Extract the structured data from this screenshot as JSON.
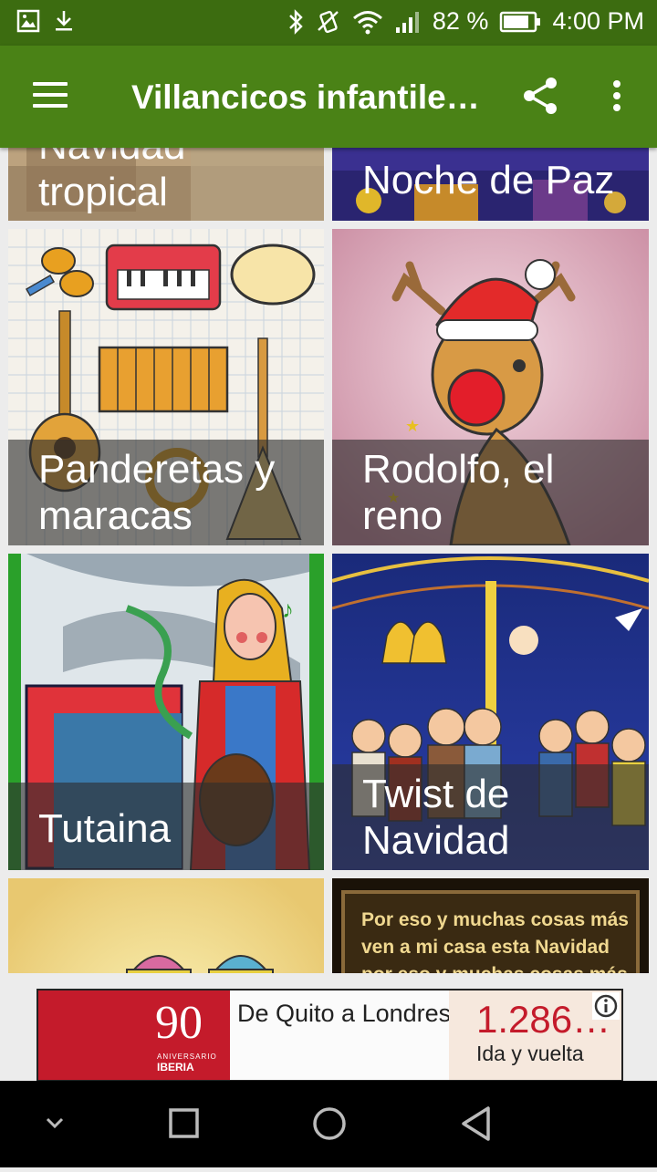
{
  "status_bar": {
    "battery_percent": "82 %",
    "time": "4:00 PM",
    "icons": [
      "gallery-icon",
      "download-icon",
      "bluetooth-icon",
      "vibrate-icon",
      "wifi-icon",
      "signal-icon",
      "battery-icon"
    ]
  },
  "app_bar": {
    "title": "Villancicos infantile…",
    "icons": [
      "menu-icon",
      "share-icon",
      "more-vert-icon"
    ],
    "color": "#4a8216"
  },
  "grid": {
    "items": [
      {
        "title_line1": "Navidad",
        "title_line2": "tropical"
      },
      {
        "title_line1": "Noche de Paz",
        "title_line2": ""
      },
      {
        "title_line1": "Panderetas y",
        "title_line2": "maracas"
      },
      {
        "title_line1": "Rodolfo, el",
        "title_line2": "reno"
      },
      {
        "title_line1": "Tutaina",
        "title_line2": ""
      },
      {
        "title_line1": "Twist de",
        "title_line2": "Navidad"
      },
      {
        "title_line1": "",
        "title_line2": ""
      },
      {
        "image_text": [
          "Por eso y muchas cosas más",
          "ven a mi casa esta Navidad",
          "por eso y muchas cosas más"
        ]
      }
    ]
  },
  "ad": {
    "brand_number": "90",
    "anniversary": "ANIVERSARIO",
    "brand": "IBERIA",
    "route": "De Quito a Londres",
    "price": "1.286…",
    "trip": "Ida y vuelta",
    "accent_color": "#c41b2b"
  },
  "nav_bar": {
    "icons": [
      "hide-nav-icon",
      "recents-icon",
      "home-icon",
      "back-icon"
    ]
  }
}
